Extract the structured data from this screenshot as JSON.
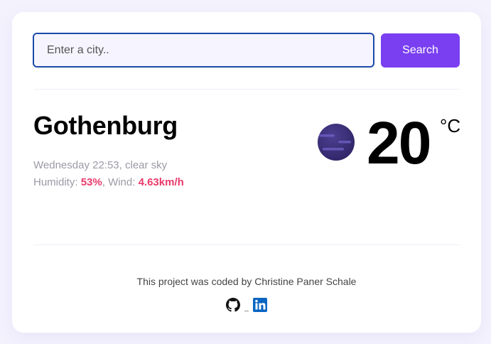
{
  "search": {
    "placeholder": "Enter a city..",
    "value": "",
    "button_label": "Search"
  },
  "current": {
    "city": "Gothenburg",
    "datetime": "Wednesday 22:53",
    "description": "clear sky",
    "humidity_label": "Humidity:",
    "humidity": "53%",
    "wind_label": "Wind:",
    "wind": "4.63km/h",
    "temperature": "20",
    "unit": "°C",
    "icon": "moon-clear-night-icon"
  },
  "footer": {
    "credit": "This project was coded by Christine Paner Schale",
    "links": [
      {
        "name": "github",
        "icon": "github-icon"
      },
      {
        "name": "linkedin",
        "icon": "linkedin-icon"
      }
    ]
  },
  "colors": {
    "accent": "#7a3ff1",
    "highlight": "#e93a6b",
    "input_border": "#1a4aa8",
    "linkedin": "#0a66c2"
  }
}
